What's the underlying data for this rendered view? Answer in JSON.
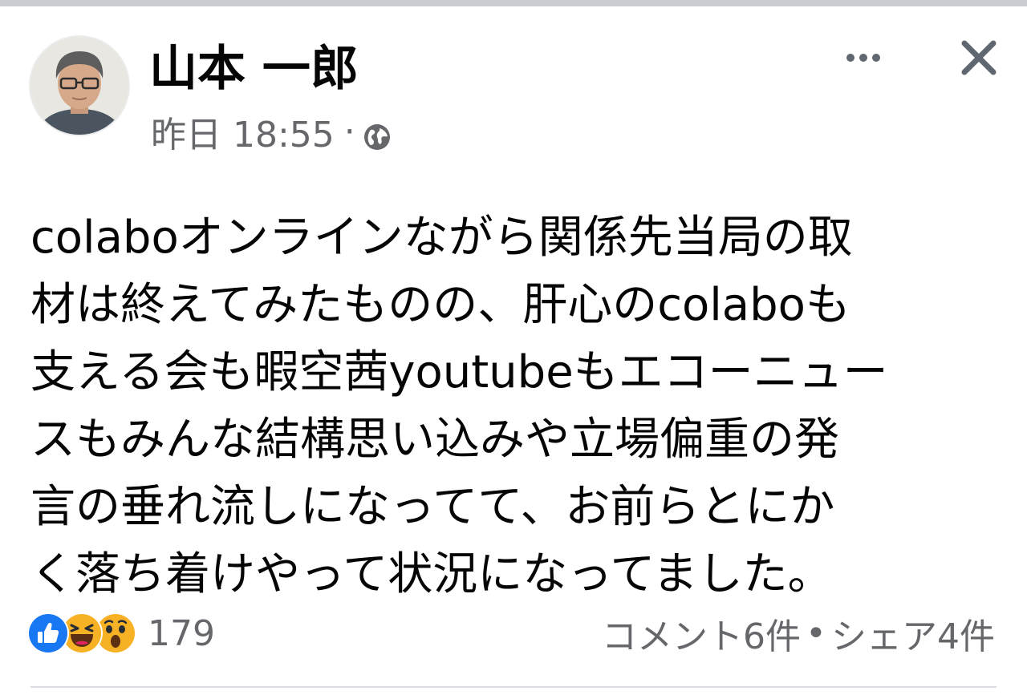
{
  "post": {
    "author_name": "山本 一郎",
    "timestamp": "昨日 18:55",
    "meta_separator": "·",
    "privacy_icon": "globe-icon",
    "text_lines": [
      "colaboオンラインながら関係先当局の取",
      "材は終えてみたものの、肝心のcolaboも",
      "支える会も暇空茜youtubeもエコーニュー",
      "スもみんな結構思い込みや立場偏重の発",
      "言の垂れ流しになってて、お前らとにか",
      "く落ち着けやって状況になってました。"
    ]
  },
  "header_actions": {
    "more_icon": "more-options-icon",
    "close_icon": "close-icon"
  },
  "footer": {
    "reaction_icons": [
      "like-icon",
      "haha-icon",
      "wow-icon"
    ],
    "reaction_count": "179",
    "comments": "コメント6件",
    "separator": "•",
    "shares": "シェア4件"
  },
  "colors": {
    "like_blue": "#1877f2",
    "emoji_yellow": "#f7b125",
    "secondary_text": "#65676b"
  }
}
